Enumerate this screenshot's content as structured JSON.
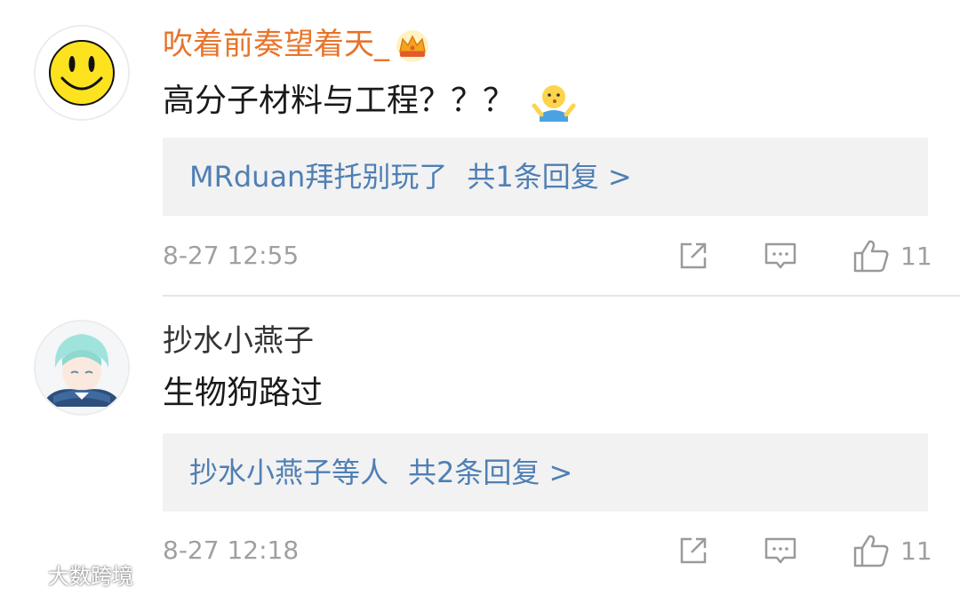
{
  "comments": [
    {
      "username": "吹着前奏望着天_",
      "vip_icon": "crown-icon",
      "text": "高分子材料与工程？？？",
      "emoji_icon": "shrug-emoji-icon",
      "reply_preview": "MRduan拜托别玩了",
      "reply_count": "共1条回复 >",
      "time": "8-27 12:55",
      "likes": "11",
      "colors": {
        "username": "#e8742a",
        "reply_link": "#4f7fb4"
      }
    },
    {
      "username": "抄水小燕子",
      "text": "生物狗路过",
      "reply_preview": "抄水小燕子等人",
      "reply_count": "共2条回复 >",
      "time": "8-27 12:18",
      "likes": "11"
    }
  ],
  "watermark": {
    "text": "大数跨境"
  }
}
